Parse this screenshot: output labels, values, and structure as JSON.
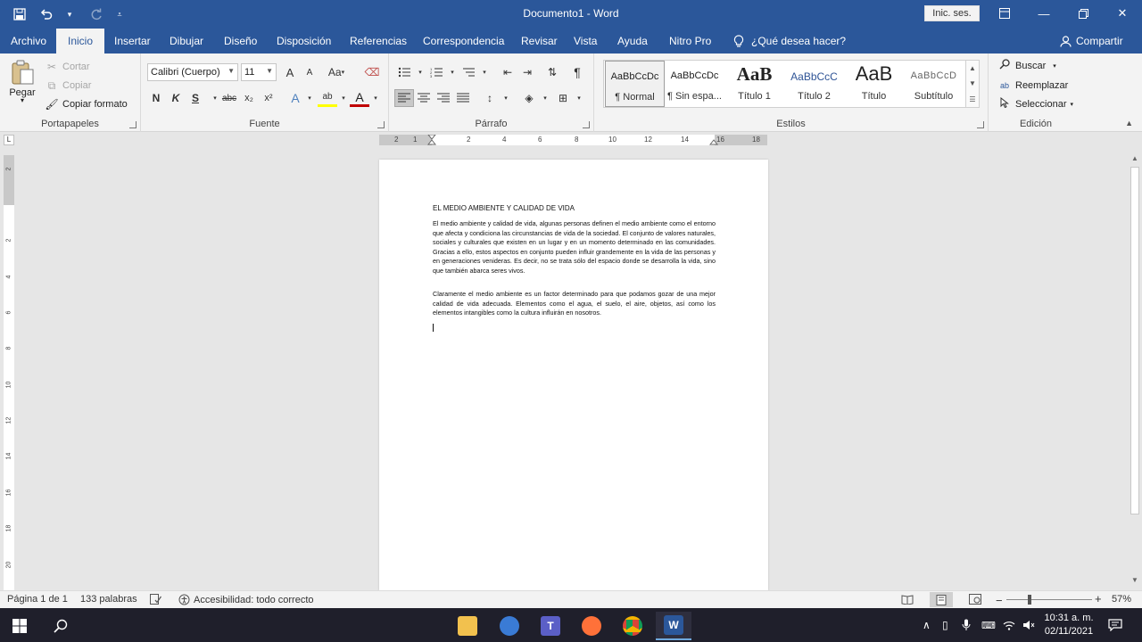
{
  "window": {
    "title": "Documento1 - Word",
    "signin": "Inic. ses.",
    "colors": {
      "brand": "#2b579a",
      "ribbon_bg": "#f3f3f3"
    }
  },
  "quick_access": {
    "save_icon": "save-icon",
    "undo_icon": "undo-icon",
    "redo_icon": "redo-icon",
    "customize_icon": "customize-icon"
  },
  "tabs": [
    {
      "label": "Archivo"
    },
    {
      "label": "Inicio"
    },
    {
      "label": "Insertar"
    },
    {
      "label": "Dibujar"
    },
    {
      "label": "Diseño"
    },
    {
      "label": "Disposición"
    },
    {
      "label": "Referencias"
    },
    {
      "label": "Correspondencia"
    },
    {
      "label": "Revisar"
    },
    {
      "label": "Vista"
    },
    {
      "label": "Ayuda"
    },
    {
      "label": "Nitro Pro"
    }
  ],
  "tell_me": "¿Qué desea hacer?",
  "share": "Compartir",
  "clipboard": {
    "paste": "Pegar",
    "cut": "Cortar",
    "copy": "Copiar",
    "format_painter": "Copiar formato",
    "label": "Portapapeles"
  },
  "font": {
    "family": "Calibri (Cuerpo)",
    "size": "11",
    "label": "Fuente",
    "bold": "N",
    "italic": "K",
    "underline": "S",
    "strike": "abc",
    "subscript": "x₂",
    "superscript": "x²",
    "grow": "A",
    "shrink": "A",
    "case": "Aa",
    "effects": "A",
    "highlight": "ab",
    "color": "A"
  },
  "paragraph": {
    "label": "Párrafo",
    "pilcrow": "¶"
  },
  "styles": {
    "label": "Estilos",
    "items": [
      {
        "preview": "AaBbCcDc",
        "name": "¶ Normal"
      },
      {
        "preview": "AaBbCcDc",
        "name": "¶ Sin espa..."
      },
      {
        "preview": "AaB",
        "name": "Título 1"
      },
      {
        "preview": "AaBbCcC",
        "name": "Título 2"
      },
      {
        "preview": "AaB",
        "name": "Título"
      },
      {
        "preview": "AaBbCcD",
        "name": "Subtítulo"
      }
    ]
  },
  "editing": {
    "label": "Edición",
    "find": "Buscar",
    "replace": "Reemplazar",
    "select": "Seleccionar"
  },
  "ruler": {
    "tab_selector": "L",
    "h_numbers": [
      "2",
      "1",
      "2",
      "4",
      "6",
      "8",
      "10",
      "12",
      "14",
      "16",
      "18"
    ],
    "v_numbers": [
      "2",
      "2",
      "4",
      "6",
      "8",
      "10",
      "12",
      "14",
      "16",
      "18",
      "20"
    ]
  },
  "document": {
    "heading": "EL MEDIO AMBIENTE Y CALIDAD DE VIDA",
    "paragraphs": [
      "El medio ambiente y calidad de vida, algunas personas definen el medio ambiente como el entorno que afecta y condiciona las circunstancias de vida de la sociedad. El conjunto de valores naturales, sociales y culturales que existen en un lugar y en un momento determinado en las comunidades. Gracias a ello, estos aspectos en conjunto pueden influir grandemente en la vida de las personas y en generaciones venideras. Es decir, no se trata sólo del espacio donde se desarrolla la vida, sino que también abarca seres vivos.",
      "Claramente el medio ambiente es un factor determinado para que podamos gozar de una mejor calidad de vida adecuada. Elementos como el agua, el suelo, el aire, objetos, así como los elementos intangibles como la cultura influirán en nosotros."
    ]
  },
  "status": {
    "page": "Página 1 de 1",
    "words": "133 palabras",
    "accessibility": "Accesibilidad: todo correcto",
    "zoom": "57%",
    "zoom_fraction": 0.57
  },
  "taskbar": {
    "time": "10:31 a. m.",
    "date": "02/11/2021",
    "apps": [
      {
        "name": "file-explorer",
        "label": ""
      },
      {
        "name": "app-2",
        "label": ""
      },
      {
        "name": "teams",
        "label": "T"
      },
      {
        "name": "firefox",
        "label": ""
      },
      {
        "name": "chrome",
        "label": ""
      },
      {
        "name": "word",
        "label": "W"
      }
    ]
  }
}
